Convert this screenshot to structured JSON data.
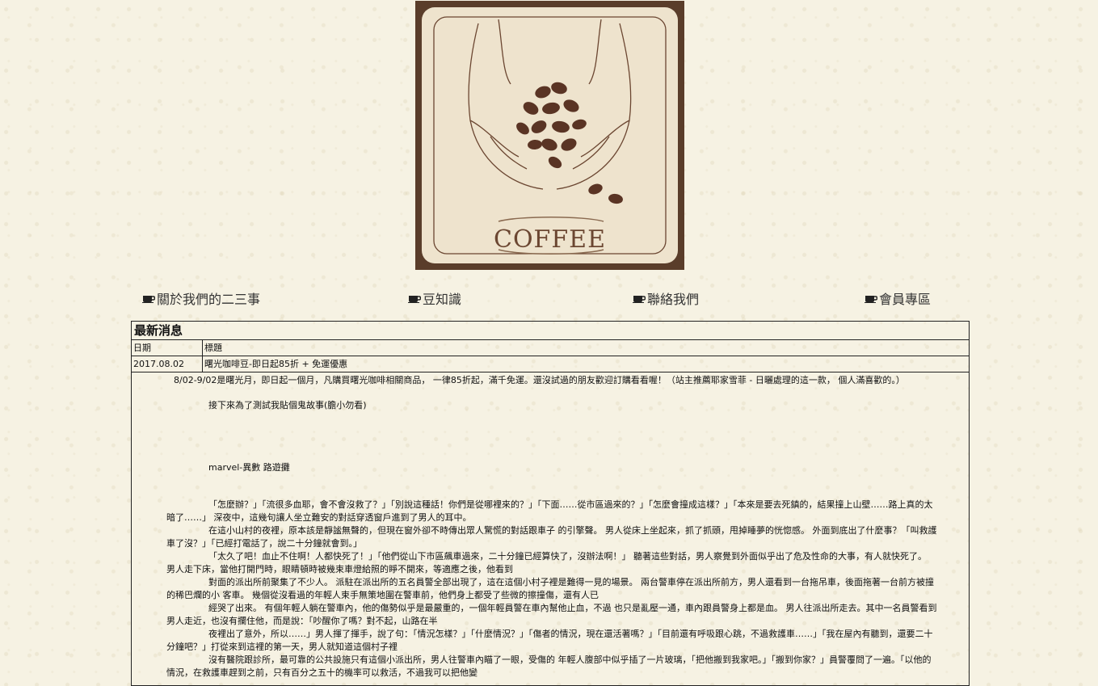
{
  "banner": {
    "label": "COFFEE",
    "icon": "coffee-hands-banner"
  },
  "nav": {
    "icon": "coffee-cup-icon",
    "items": [
      {
        "label": "關於我們的二三事"
      },
      {
        "label": "豆知識"
      },
      {
        "label": "聯絡我們"
      },
      {
        "label": "會員專區"
      }
    ]
  },
  "news": {
    "title": "最新消息",
    "header": {
      "date": "日期",
      "title": "標題"
    },
    "rows": [
      {
        "date": "2017.08.02",
        "title": "曙光咖啡豆-即日起85折 + 免運優惠"
      }
    ],
    "summary": "8/02-9/02是曙光月，即日起一個月，凡購買曙光咖啡相關商品， 一律85折起，滿千免運。還沒試過的朋友歡迎訂購看看喔！（站主推薦耶家雪菲 - 日曬處理的這一款， 個人滿喜歡的。）",
    "intro": "接下來為了測試我貼個鬼故事(膽小勿看)",
    "story_title": "marvel-異數 路遊攤",
    "paragraphs": [
      "「怎麼辦？」「流很多血耶，會不會沒救了？」「別說這種話！你們是從哪裡來的？」「下面……從市區過來的？」「怎麼會撞成這樣？」「本來是要去死鎮的，結果撞上山壁……路上真的太暗了……」 深夜中，這幾句讓人坐立難安的對話穿透窗戶進到了男人的耳中。",
      "在這小山村的夜裡，原本該是靜謐無聲的，但現在窗外卻不時傳出眾人驚慌的對話跟車子 的引擎聲。 男人從床上坐起來，抓了抓頭，甩掉睡夢的恍惚感。 外面到底出了什麼事？「叫救護車了沒？」「已經打電話了，說二十分鐘就會到。」",
      "「太久了吧！血止不住啊！人都快死了！」「他們從山下市區飆車過來，二十分鐘已經算快了，沒辦法啊！」 聽著這些對話，男人察覺到外面似乎出了危及性命的大事，有人就快死了。 男人走下床，當他打開門時，眼睛頓時被幾束車燈給照的睜不開來，等適應之後，他看到",
      "對面的派出所前聚集了不少人。 派駐在派出所的五名員警全部出現了，這在這個小村子裡是難得一見的場景。 兩台警車停在派出所前方，男人還看到一台拖吊車，後面拖著一台前方被撞的稀巴爛的小 客車。 幾個從沒看過的年輕人束手無策地圍在警車前，他們身上都受了些微的擦撞傷，還有人已",
      "經哭了出來。 有個年輕人躺在警車內，他的傷勢似乎是最嚴重的，一個年輕員警在車內幫他止血，不過 也只是亂壓一通，車內跟員警身上都是血。 男人往派出所走去。其中一名員警看到男人走近，也沒有攔住他，而是說：「吵醒你了嗎？對不起，山路在半",
      "夜裡出了意外，所以……」男人揮了揮手，說了句：「情況怎樣？」「什麼情況？」「傷者的情況，現在還活著嗎？」「目前還有呼吸跟心跳，不過救護車……」「我在屋內有聽到，還要二十分鐘吧？」打從來到這裡的第一天，男人就知道這個村子裡",
      "沒有醫院跟診所，最可靠的公共設施只有這個小派出所，男人往警車內瞄了一眼，受傷的 年輕人腹部中似乎插了一片玻璃，「把他搬到我家吧。」「搬到你家？」員警覆問了一遍。「以他的情況，在救護車趕到之前，只有百分之五十的機率可以救活，不過我可以把他變"
    ]
  }
}
